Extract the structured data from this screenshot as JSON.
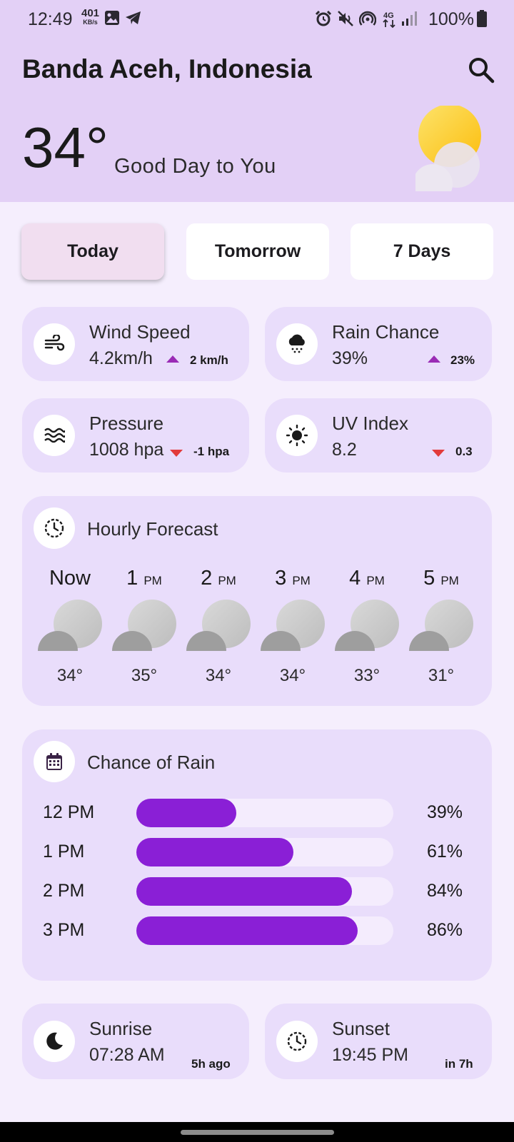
{
  "status_bar": {
    "time": "12:49",
    "net_speed": "401",
    "net_unit": "KB/s",
    "battery": "100%",
    "icons": [
      "image-icon",
      "telegram-icon",
      "alarm-icon",
      "mute-icon",
      "hotspot-icon",
      "4g-icon",
      "signal-icon",
      "battery-icon"
    ]
  },
  "header": {
    "city": "Banda Aceh, Indonesia",
    "temperature": "34°",
    "greeting": "Good Day to You",
    "search_icon": "search-icon",
    "weather_icon": "sun-cloud-icon"
  },
  "tabs": [
    {
      "label": "Today",
      "active": true
    },
    {
      "label": "Tomorrow",
      "active": false
    },
    {
      "label": "7 Days",
      "active": false
    }
  ],
  "stats": {
    "wind": {
      "title": "Wind Speed",
      "value": "4.2km/h",
      "change": "2 km/h",
      "trend": "up",
      "icon": "wind-icon"
    },
    "rain": {
      "title": "Rain Chance",
      "value": "39%",
      "change": "23%",
      "trend": "up",
      "icon": "rain-cloud-icon"
    },
    "pressure": {
      "title": "Pressure",
      "value": "1008 hpa",
      "change": "-1 hpa",
      "trend": "down",
      "icon": "waves-icon"
    },
    "uv": {
      "title": "UV Index",
      "value": "8.2",
      "change": "0.3",
      "trend": "down",
      "icon": "sun-icon"
    }
  },
  "hourly": {
    "title": "Hourly Forecast",
    "icon": "clock-icon",
    "items": [
      {
        "hour": "Now",
        "ampm": "",
        "temp": "34°"
      },
      {
        "hour": "1",
        "ampm": "PM",
        "temp": "35°"
      },
      {
        "hour": "2",
        "ampm": "PM",
        "temp": "34°"
      },
      {
        "hour": "3",
        "ampm": "PM",
        "temp": "34°"
      },
      {
        "hour": "4",
        "ampm": "PM",
        "temp": "33°"
      },
      {
        "hour": "5",
        "ampm": "PM",
        "temp": "31°"
      }
    ]
  },
  "chance_of_rain": {
    "title": "Chance of Rain",
    "icon": "calendar-icon",
    "rows": [
      {
        "time": "12 PM",
        "percent": "39%",
        "value": 39
      },
      {
        "time": "1 PM",
        "percent": "61%",
        "value": 61
      },
      {
        "time": "2 PM",
        "percent": "84%",
        "value": 84
      },
      {
        "time": "3 PM",
        "percent": "86%",
        "value": 86
      }
    ]
  },
  "sun": {
    "sunrise": {
      "title": "Sunrise",
      "time": "07:28 AM",
      "relative": "5h ago",
      "icon": "moon-icon"
    },
    "sunset": {
      "title": "Sunset",
      "time": "19:45 PM",
      "relative": "in 7h",
      "icon": "clock-icon"
    }
  },
  "colors": {
    "header_bg": "#e3d0f6",
    "page_bg": "#f5eefd",
    "card_bg": "#e9ddfb",
    "bar_fill": "#8a1fd6",
    "trend_up": "#9a2bb5",
    "trend_down": "#e23b3b"
  }
}
